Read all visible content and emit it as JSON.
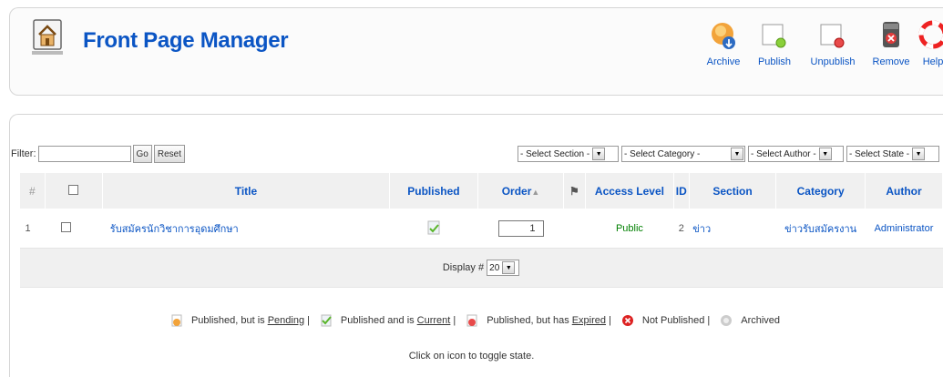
{
  "header": {
    "title": "Front Page Manager"
  },
  "toolbar": [
    {
      "label": "Archive",
      "icon": "archive-icon"
    },
    {
      "label": "Publish",
      "icon": "publish-icon"
    },
    {
      "label": "Unpublish",
      "icon": "unpublish-icon"
    },
    {
      "label": "Remove",
      "icon": "remove-icon"
    },
    {
      "label": "Help",
      "icon": "help-icon"
    }
  ],
  "filter": {
    "label": "Filter:",
    "value": "",
    "go_label": "Go",
    "reset_label": "Reset"
  },
  "selects": {
    "section": "- Select Section -",
    "category": "- Select Category -",
    "author": "- Select Author -",
    "state": "- Select State -"
  },
  "table": {
    "headers": {
      "num": "#",
      "title": "Title",
      "published": "Published",
      "order": "Order",
      "access": "Access Level",
      "id": "ID",
      "section": "Section",
      "category": "Category",
      "author": "Author"
    },
    "rows": [
      {
        "num": "1",
        "title": "รับสมัครนักวิชาการอุดมศึกษา",
        "order": "1",
        "access": "Public",
        "id": "2",
        "section": "ข่าว",
        "category": "ข่าวรับสมัครงาน",
        "author": "Administrator"
      }
    ],
    "display_label": "Display #",
    "display_value": "20"
  },
  "legend": {
    "pending_prefix": "Published, but is ",
    "pending_link": "Pending",
    "current_prefix": "Published and is ",
    "current_link": "Current",
    "expired_prefix": "Published, but has ",
    "expired_link": "Expired",
    "not_published": "Not Published",
    "archived": "Archived",
    "sep": "|"
  },
  "toggle_note": "Click on icon to toggle state.",
  "colors": {
    "accent": "#0b55c4",
    "access_public": "#008000",
    "header_bg": "#f0f0f0"
  }
}
